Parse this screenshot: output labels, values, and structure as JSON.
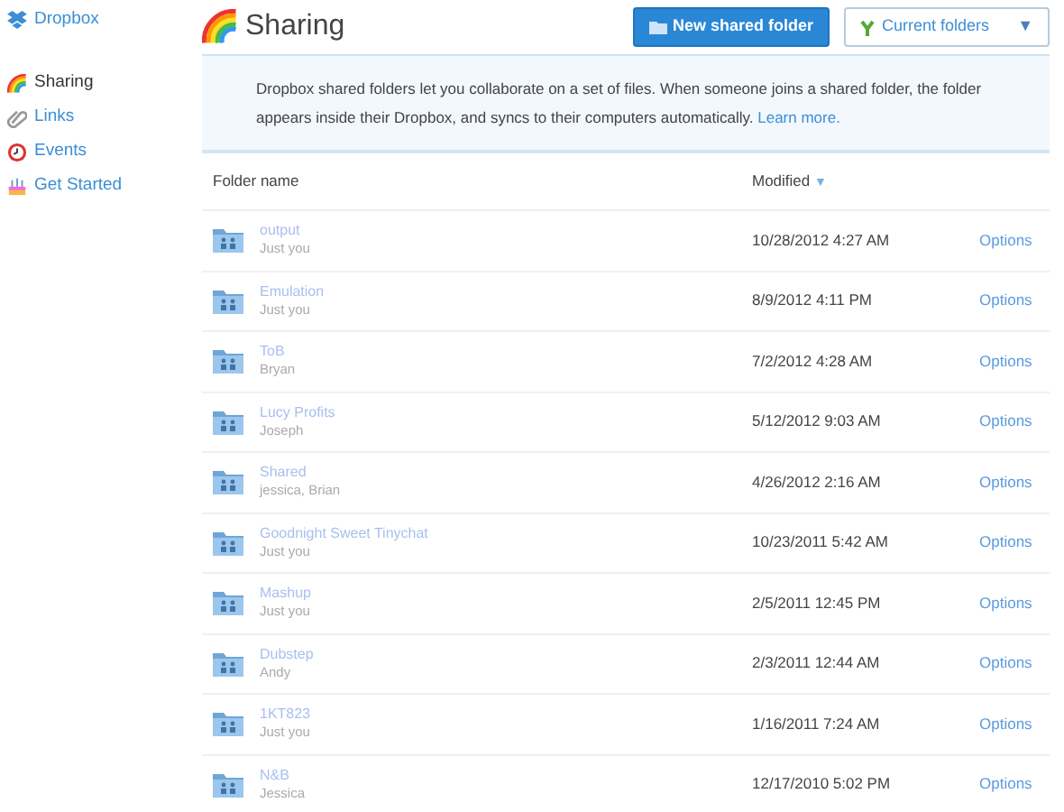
{
  "sidebar": {
    "brand": "Dropbox",
    "items": [
      {
        "label": "Sharing",
        "selected": true
      },
      {
        "label": "Links",
        "selected": false
      },
      {
        "label": "Events",
        "selected": false
      },
      {
        "label": "Get Started",
        "selected": false
      }
    ]
  },
  "header": {
    "title": "Sharing",
    "new_button": "New shared folder",
    "filter": "Current folders",
    "filter_caret": "▼"
  },
  "info": {
    "text": "Dropbox shared folders let you collaborate on a set of files. When someone joins a shared folder, the folder appears inside their Dropbox, and syncs to their computers automatically.",
    "link": "Learn more."
  },
  "table": {
    "columns": [
      "Folder name",
      "Modified"
    ],
    "sort_caret": "▼",
    "rows": [
      {
        "name": "output",
        "members": "Just you",
        "modified": "10/28/2012 4:27 AM",
        "action": "Options"
      },
      {
        "name": "Emulation",
        "members": "Just you",
        "modified": "8/9/2012 4:11 PM",
        "action": "Options"
      },
      {
        "name": "ToB",
        "members": "Bryan",
        "modified": "7/2/2012 4:28 AM",
        "action": "Options"
      },
      {
        "name": "Lucy Profits",
        "members": "Joseph",
        "modified": "5/12/2012 9:03 AM",
        "action": "Options"
      },
      {
        "name": "Shared",
        "members": "jessica, Brian",
        "modified": "4/26/2012 2:16 AM",
        "action": "Options"
      },
      {
        "name": "Goodnight Sweet Tinychat",
        "members": "Just you",
        "modified": "10/23/2011 5:42 AM",
        "action": "Options"
      },
      {
        "name": "Mashup",
        "members": "Just you",
        "modified": "2/5/2011 12:45 PM",
        "action": "Options"
      },
      {
        "name": "Dubstep",
        "members": "Andy",
        "modified": "2/3/2011 12:44 AM",
        "action": "Options"
      },
      {
        "name": "1KT823",
        "members": "Just you",
        "modified": "1/16/2011 7:24 AM",
        "action": "Options"
      },
      {
        "name": "N&B",
        "members": "Jessica",
        "modified": "12/17/2010 5:02 PM",
        "action": "Options"
      }
    ]
  }
}
